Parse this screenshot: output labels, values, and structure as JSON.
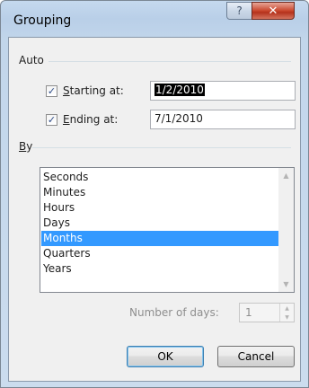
{
  "window": {
    "title": "Grouping",
    "help_glyph": "?",
    "close_glyph": "✕"
  },
  "auto": {
    "label": "Auto",
    "starting": {
      "checked": true,
      "label_mnemonic": "S",
      "label_rest": "tarting at:",
      "value": "1/2/2010"
    },
    "ending": {
      "checked": true,
      "label_mnemonic": "E",
      "label_rest": "nding at:",
      "value": "7/1/2010"
    }
  },
  "by": {
    "label_mnemonic": "B",
    "label_rest": "y",
    "items": [
      "Seconds",
      "Minutes",
      "Hours",
      "Days",
      "Months",
      "Quarters",
      "Years"
    ],
    "selected": "Months"
  },
  "number_of_days": {
    "label": "Number of days:",
    "value": "1"
  },
  "buttons": {
    "ok": "OK",
    "cancel": "Cancel"
  },
  "icons": {
    "checkmark": "check-icon",
    "scroll_up": "scroll-up-arrow-icon",
    "scroll_down": "scroll-down-arrow-icon"
  }
}
